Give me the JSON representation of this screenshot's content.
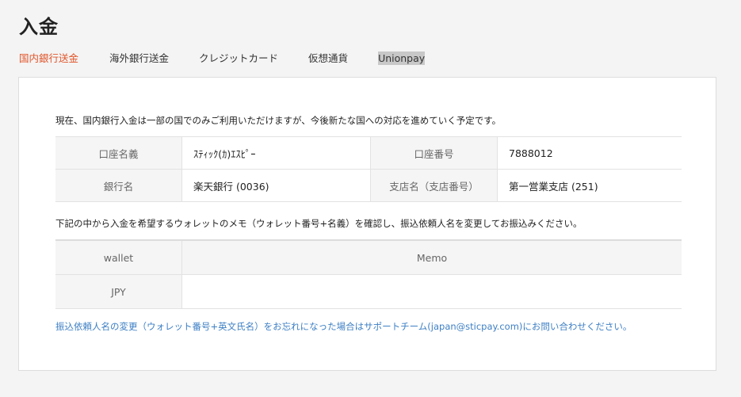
{
  "page": {
    "title": "入金"
  },
  "tabs": [
    {
      "label": "国内銀行送金",
      "active": true
    },
    {
      "label": "海外銀行送金",
      "active": false
    },
    {
      "label": "クレジットカード",
      "active": false
    },
    {
      "label": "仮想通貨",
      "active": false
    },
    {
      "label": "Unionpay",
      "active": false
    }
  ],
  "domestic": {
    "intro": "現在、国内銀行入金は一部の国でのみご利用いただけますが、今後新たな国への対応を進めていく予定です。",
    "account_holder_label": "口座名義",
    "account_holder_value": "ｽﾃｨｯｸ(ｶ)ｴｽﾋﾟｰ",
    "account_number_label": "口座番号",
    "account_number_value": "7888012",
    "bank_name_label": "銀行名",
    "bank_name_value": "楽天銀行 (0036)",
    "branch_label": "支店名（支店番号）",
    "branch_value": "第一営業支店 (251)",
    "instruction": "下記の中から入金を希望するウォレットのメモ（ウォレット番号+名義）を確認し、振込依頼人名を変更してお振込みください。",
    "wallet_table": {
      "col_wallet": "wallet",
      "col_memo": "Memo",
      "rows": [
        {
          "wallet": "JPY",
          "memo": ""
        }
      ]
    },
    "note": "振込依頼人名の変更（ウォレット番号+英文氏名）をお忘れになった場合はサポートチーム(japan@sticpay.com)にお問い合わせください。"
  },
  "colors": {
    "accent": "#e0552a",
    "link": "#3d7fc4"
  }
}
